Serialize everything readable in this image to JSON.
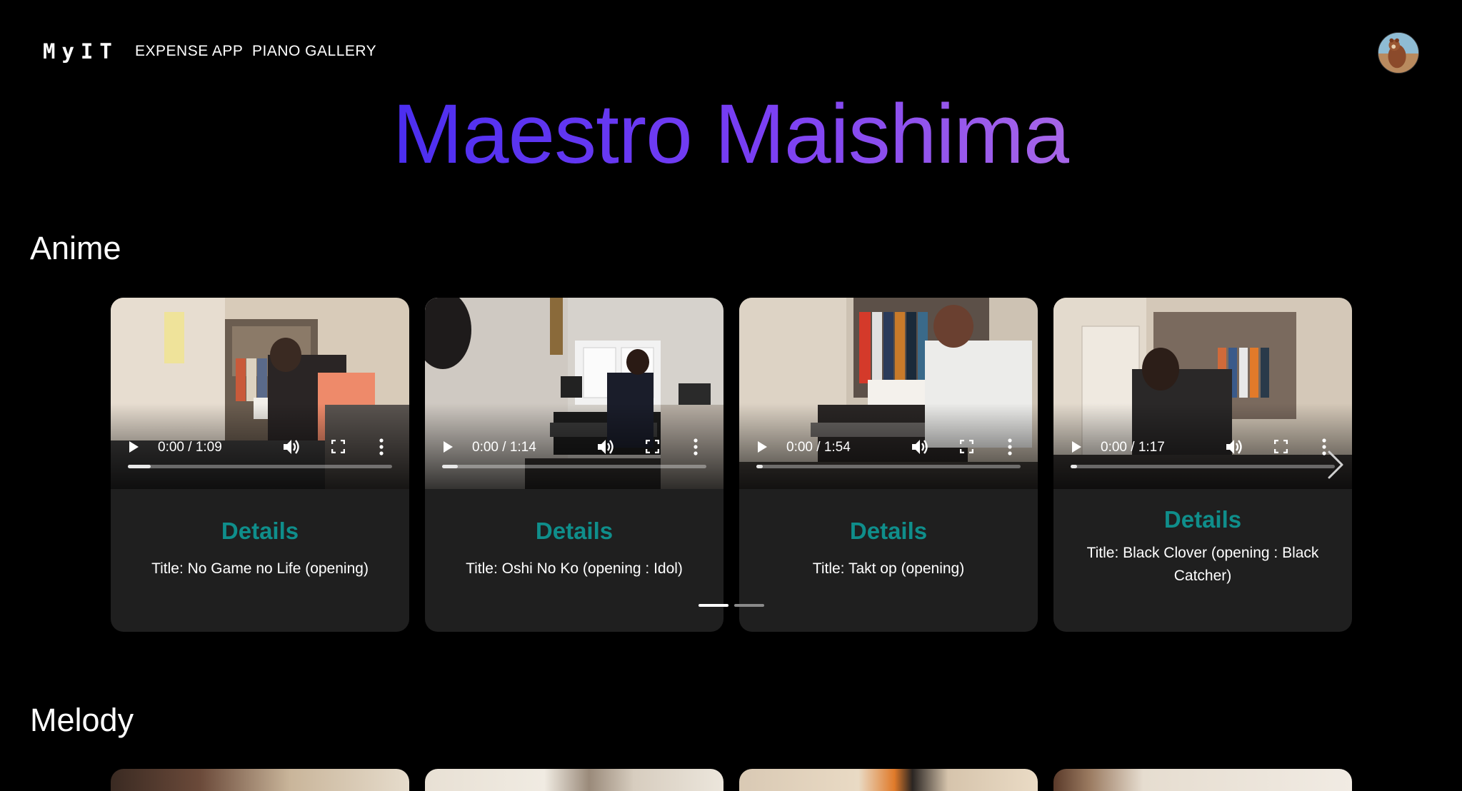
{
  "nav": {
    "logo": "MyIT",
    "links": [
      {
        "label": "EXPENSE APP"
      },
      {
        "label": "PIANO GALLERY"
      }
    ]
  },
  "hero": {
    "title": "Maestro Maishima"
  },
  "sections": [
    {
      "title": "Anime",
      "cards": [
        {
          "time": "0:00 / 1:09",
          "details_label": "Details",
          "title": "Title: No Game no Life (opening)"
        },
        {
          "time": "0:00 / 1:14",
          "details_label": "Details",
          "title": "Title: Oshi No Ko (opening : Idol)"
        },
        {
          "time": "0:00 / 1:54",
          "details_label": "Details",
          "title": "Title: Takt op (opening)"
        },
        {
          "time": "0:00 / 1:17",
          "details_label": "Details",
          "title": "Title: Black Clover (opening : Black Catcher)"
        }
      ],
      "carousel": {
        "active_page": 1,
        "page_count": 2
      }
    },
    {
      "title": "Melody"
    }
  ],
  "colors": {
    "title_gradient_start": "#4b2ef0",
    "title_gradient_end": "#a766e8",
    "details_accent": "#0f8e8b",
    "card_bg": "#1f1f1f"
  },
  "icons": {
    "play": "play-icon",
    "volume": "volume-icon",
    "fullscreen": "fullscreen-icon",
    "more": "more-vertical-icon",
    "next": "chevron-right-icon"
  }
}
